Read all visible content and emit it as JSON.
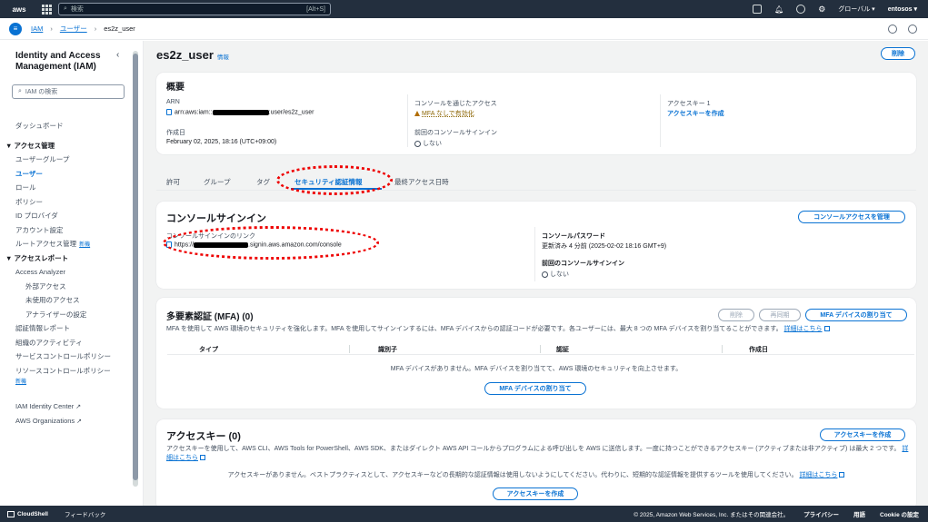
{
  "topbar": {
    "logo": "aws",
    "search_placeholder": "検索",
    "search_shortcut": "[Alt+S]",
    "region": "グローバル ▾",
    "account": "entosos ▾"
  },
  "breadcrumb": [
    "IAM",
    "ユーザー",
    "es2z_user"
  ],
  "sidebar": {
    "title": "Identity and Access Management (IAM)",
    "search_placeholder": "IAM の検索",
    "items": [
      {
        "label": "ダッシュボード"
      },
      {
        "label": "▼ アクセス管理"
      },
      {
        "label": "ユーザーグループ"
      },
      {
        "label": "ユーザー"
      },
      {
        "label": "ロール"
      },
      {
        "label": "ポリシー"
      },
      {
        "label": "ID プロバイダ"
      },
      {
        "label": "アカウント設定"
      },
      {
        "label": "ルートアクセス管理",
        "badge": "新機"
      },
      {
        "label": "▼ アクセスレポート"
      },
      {
        "label": "Access Analyzer"
      },
      {
        "label": "外部アクセス"
      },
      {
        "label": "未使用のアクセス"
      },
      {
        "label": "アナライザーの設定"
      },
      {
        "label": "認証情報レポート"
      },
      {
        "label": "組織のアクティビティ"
      },
      {
        "label": "サービスコントロールポリシー"
      },
      {
        "label": "リソースコントロールポリシー",
        "badge": "新機"
      },
      {
        "label": "IAM Identity Center"
      },
      {
        "label": "AWS Organizations"
      }
    ]
  },
  "page": {
    "title": "es2z_user",
    "info": "情報",
    "delete_button": "削除"
  },
  "summary": {
    "heading": "概要",
    "arn_label": "ARN",
    "arn_prefix": "arn:aws:iam::",
    "arn_suffix": ":user/es2z_user",
    "created_label": "作成日",
    "created_value": "February 02, 2025, 18:16 (UTC+09:00)",
    "console_access_label": "コンソールを通じたアクセス",
    "console_access_value": "MFA なしで有効化",
    "last_signin_label": "前回のコンソールサインイン",
    "last_signin_value": "しない",
    "access_key_label": "アクセスキー 1",
    "access_key_link": "アクセスキーを作成"
  },
  "tabs": [
    "許可",
    "グループ",
    "タグ",
    "セキュリティ認証情報",
    "最終アクセス日時"
  ],
  "console_signin": {
    "heading": "コンソールサインイン",
    "manage_button": "コンソールアクセスを管理",
    "link_label": "コンソールサインインのリンク",
    "link_prefix": "https://",
    "link_suffix": ".signin.aws.amazon.com/console",
    "password_label": "コンソールパスワード",
    "password_value": "更新済み 4 分前 (2025-02-02 18:16 GMT+9)",
    "last_signin_label": "前回のコンソールサインイン",
    "last_signin_value": "しない"
  },
  "mfa": {
    "heading": "多要素認証 (MFA) (0)",
    "remove_button": "削除",
    "resync_button": "再同期",
    "assign_button": "MFA デバイスの割り当て",
    "description": "MFA を使用して AWS 環境のセキュリティを強化します。MFA を使用してサインインするには、MFA デバイスからの認証コードが必要です。各ユーザーには、最大 8 つの MFA デバイスを割り当てることができます。",
    "learn_more": "詳細はこちら",
    "columns": [
      "タイプ",
      "識別子",
      "認証",
      "作成日"
    ],
    "empty_text": "MFA デバイスがありません。MFA デバイスを割り当てて、AWS 環境のセキュリティを向上させます。",
    "empty_button": "MFA デバイスの割り当て"
  },
  "access_keys": {
    "heading": "アクセスキー (0)",
    "create_button": "アクセスキーを作成",
    "description": "アクセスキーを使用して、AWS CLI、AWS Tools for PowerShell、AWS SDK、またはダイレクト AWS API コールからプログラムによる呼び出しを AWS に送信します。一度に持つことができるアクセスキー (アクティブまたは非アクティブ) は最大 2 つです。",
    "learn_more": "詳細はこちら",
    "empty_text": "アクセスキーがありません。ベストプラクティスとして、アクセスキーなどの長期的な認証情報は使用しないようにしてください。代わりに、短期的な認証情報を提供するツールを使用してください。",
    "empty_learn_more": "詳細はこちら",
    "empty_button": "アクセスキーを作成"
  },
  "footer": {
    "cloudshell": "CloudShell",
    "feedback": "フィードバック",
    "copyright": "© 2025, Amazon Web Services, Inc. またはその関連会社。",
    "privacy": "プライバシー",
    "terms": "用語",
    "cookie": "Cookie の設定"
  }
}
